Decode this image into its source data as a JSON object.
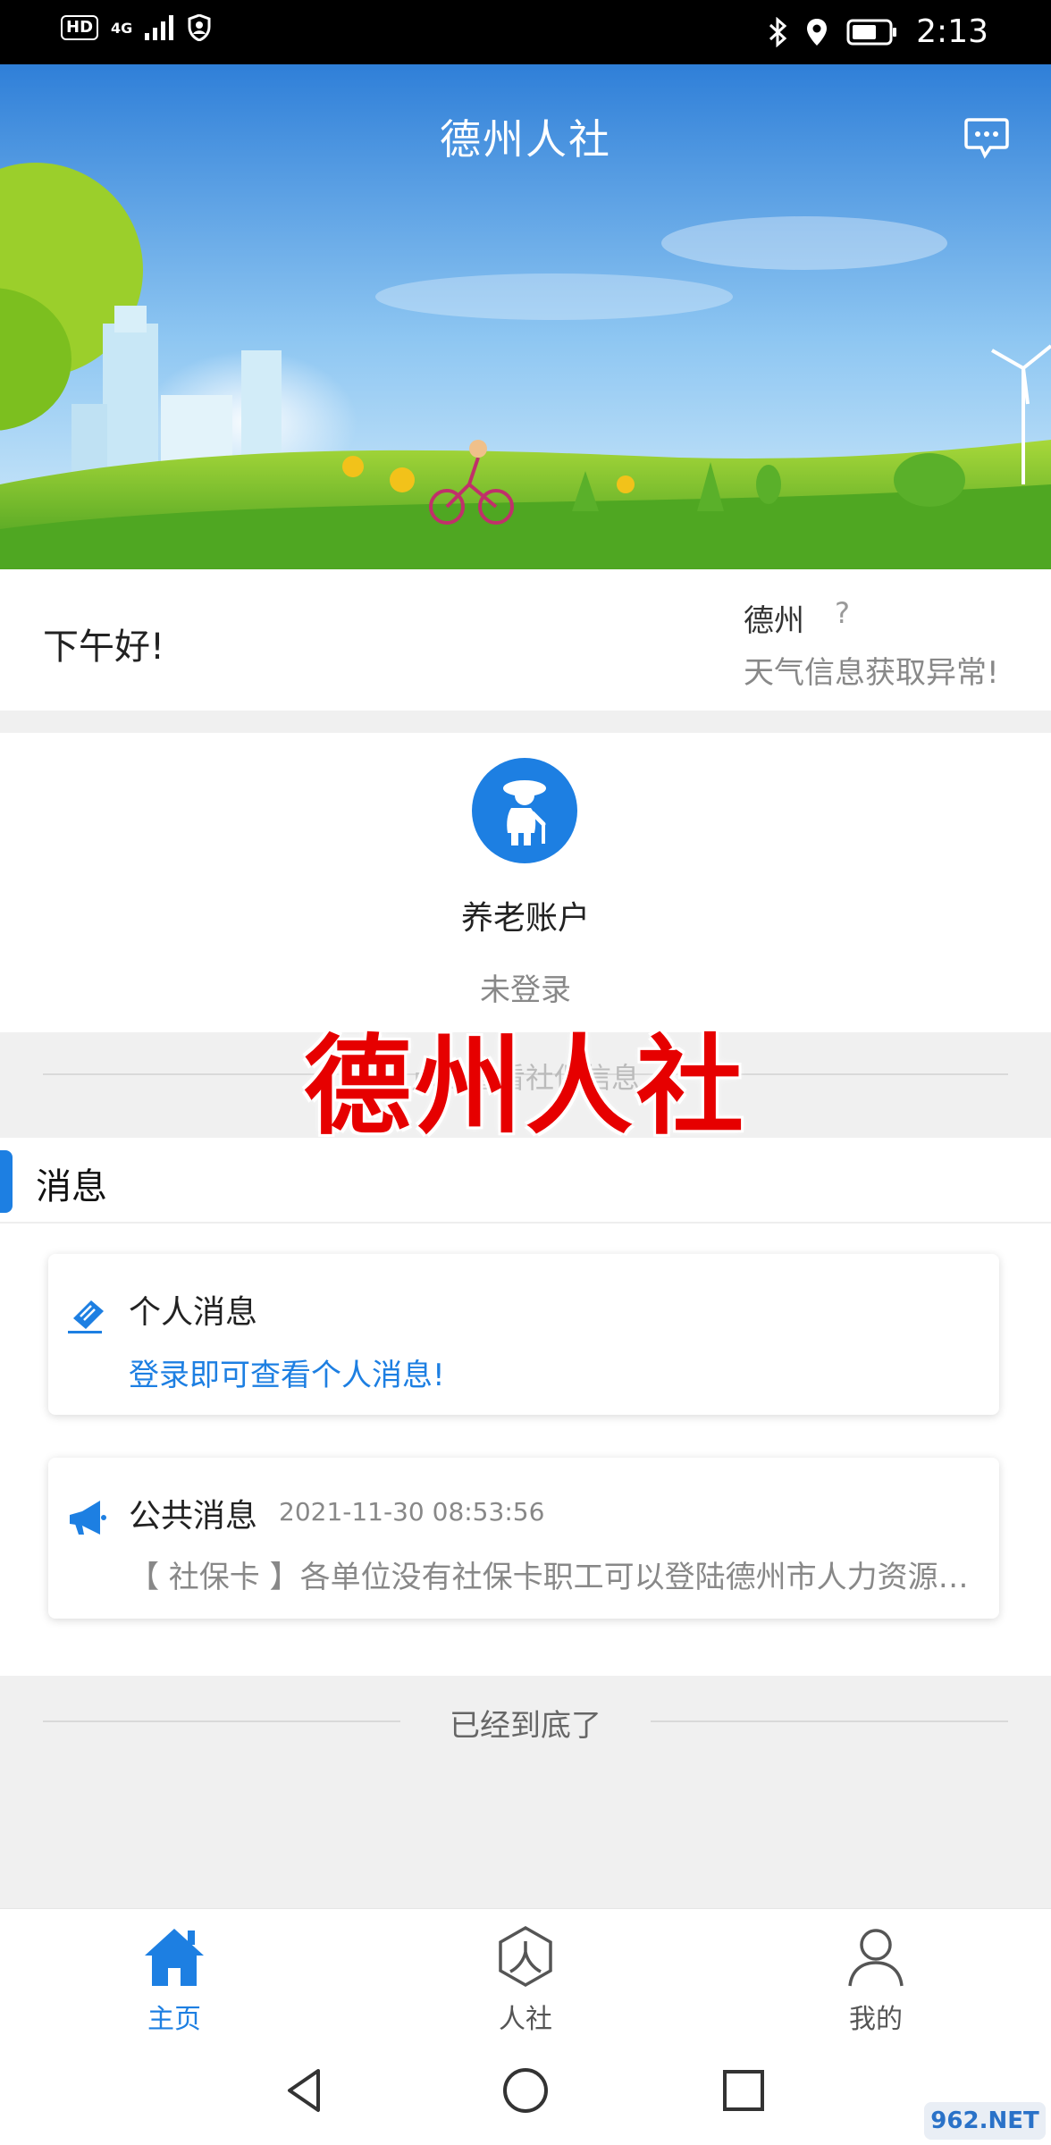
{
  "status_bar": {
    "hd": "HD",
    "network": "4G",
    "time": "2:13"
  },
  "header": {
    "title": "德州人社"
  },
  "greeting": {
    "text": "下午好!",
    "city": "德州",
    "weather_icon": "?",
    "weather_msg": "天气信息获取异常!"
  },
  "pension": {
    "label": "养老账户",
    "status": "未登录",
    "hint": "点击查看社保信息"
  },
  "watermark": "德州人社",
  "messages": {
    "title": "消息",
    "personal": {
      "title": "个人消息",
      "link": "登录即可查看个人消息!"
    },
    "public": {
      "title": "公共消息",
      "date": "2021-11-30 08:53:56",
      "body": "【 社保卡 】各单位没有社保卡职工可以登陆德州市人力资源和社会保障局网站查询办理"
    }
  },
  "end_text": "已经到底了",
  "tabs": [
    {
      "label": "主页",
      "icon": "home-icon",
      "active": true
    },
    {
      "label": "人社",
      "icon": "renshe-icon",
      "active": false
    },
    {
      "label": "我的",
      "icon": "user-icon",
      "active": false
    }
  ],
  "corner_logo": "962.NET",
  "colors": {
    "accent": "#1d7fe2",
    "watermark": "#e60000"
  }
}
